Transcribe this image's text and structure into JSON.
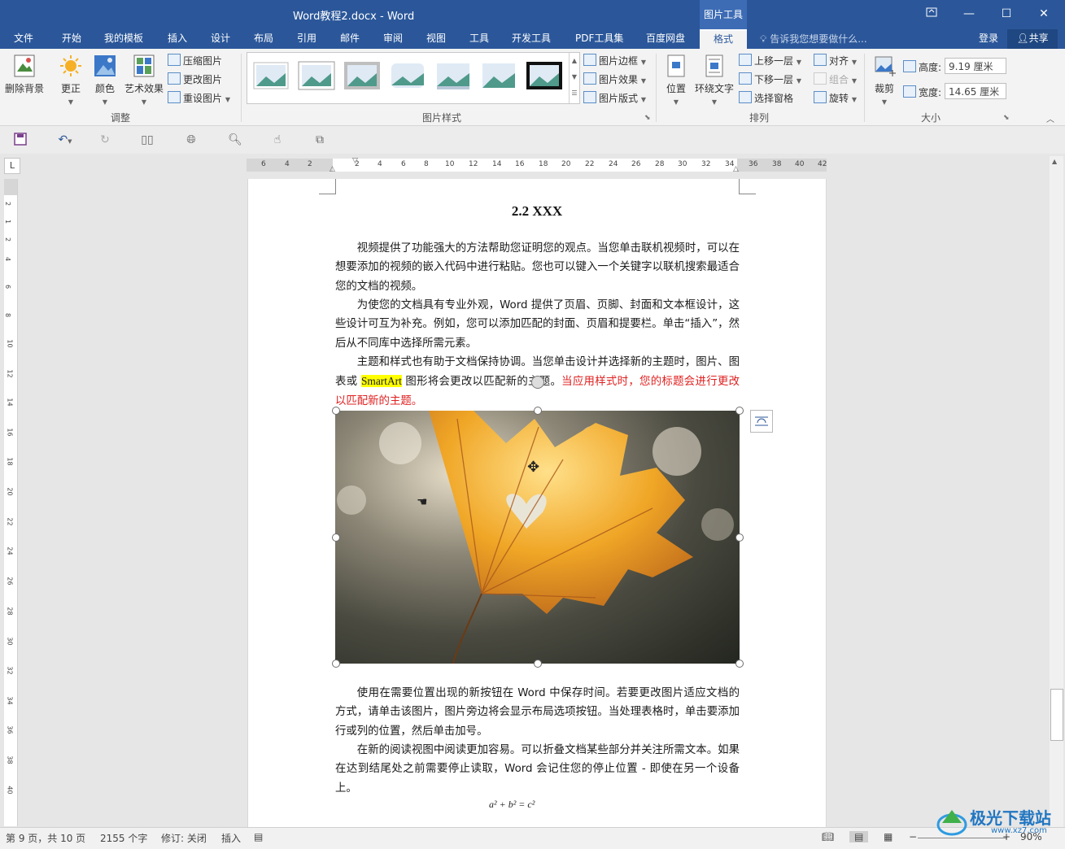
{
  "window": {
    "title": "Word教程2.docx - Word",
    "context_group": "图片工具",
    "restore_icon": "ribbon-display-icon",
    "minimize": "—",
    "maximize": "☐",
    "close": "✕"
  },
  "tabs": [
    "文件",
    "开始",
    "我的模板",
    "插入",
    "设计",
    "布局",
    "引用",
    "邮件",
    "审阅",
    "视图",
    "工具",
    "开发工具",
    "PDF工具集",
    "百度网盘",
    "格式"
  ],
  "active_tab": "格式",
  "tell_me": "告诉我您想要做什么...",
  "login": "登录",
  "share": "共享",
  "ribbon": {
    "adjust": {
      "remove_bg": "删除背景",
      "corrections": "更正",
      "color": "颜色",
      "artistic": "艺术效果",
      "compress": "压缩图片",
      "change": "更改图片",
      "reset": "重设图片",
      "label": "调整"
    },
    "styles": {
      "border": "图片边框",
      "effects": "图片效果",
      "layout": "图片版式",
      "label": "图片样式"
    },
    "arrange": {
      "position": "位置",
      "wrap": "环绕文字",
      "forward": "上移一层",
      "backward": "下移一层",
      "selection": "选择窗格",
      "align": "对齐",
      "group": "组合",
      "rotate": "旋转",
      "label": "排列"
    },
    "size": {
      "crop": "裁剪",
      "height_label": "高度:",
      "height_value": "9.19 厘米",
      "width_label": "宽度:",
      "width_value": "14.65 厘米",
      "label": "大小"
    }
  },
  "ruler": {
    "h_numbers": [
      "6",
      "4",
      "2",
      "2",
      "4",
      "6",
      "8",
      "10",
      "12",
      "14",
      "16",
      "18",
      "20",
      "22",
      "24",
      "26",
      "28",
      "30",
      "32",
      "34",
      "36",
      "38",
      "40",
      "42"
    ],
    "v_numbers": [
      "2",
      "1",
      "2",
      "4",
      "6",
      "8",
      "10",
      "12",
      "14",
      "16",
      "18",
      "20",
      "22",
      "24",
      "26",
      "28",
      "30",
      "32",
      "34",
      "36",
      "38",
      "40"
    ],
    "tab_selector": "L"
  },
  "document": {
    "heading": "2.2 XXX",
    "p1": "视频提供了功能强大的方法帮助您证明您的观点。当您单击联机视频时，可以在想要添加的视频的嵌入代码中进行粘贴。您也可以键入一个关键字以联机搜索最适合您的文档的视频。",
    "p2": "为使您的文档具有专业外观，Word 提供了页眉、页脚、封面和文本框设计，这些设计可互为补充。例如，您可以添加匹配的封面、页眉和提要栏。单击“插入”，然后从不同库中选择所需元素。",
    "p3_a": "主题和样式也有助于文档保持协调。当您单击设计并选择新的主题时，图片、图表或 ",
    "p3_hl": "SmartArt",
    "p3_b": " 图形将会更改以匹配新的主题。",
    "p3_red": "当应用样式时，您的标题会进行更改以匹配新的主题。",
    "p4": "使用在需要位置出现的新按钮在 Word 中保存时间。若要更改图片适应文档的方式，请单击该图片，图片旁边将会显示布局选项按钮。当处理表格时，单击要添加行或列的位置，然后单击加号。",
    "p5": "在新的阅读视图中阅读更加容易。可以折叠文档某些部分并关注所需文本。如果在达到结尾处之前需要停止读取，Word 会记住您的停止位置 - 即使在另一个设备上。",
    "formula": "a² + b² = c²"
  },
  "status": {
    "page": "第 9 页，共 10 页",
    "words": "2155 个字",
    "revision": "修订: 关闭",
    "insert": "插入",
    "zoom": "90%"
  },
  "watermark": "极光下载站",
  "watermark_url": "www.xz7.com",
  "colors": {
    "brand": "#2b579a",
    "highlight": "#ffff00",
    "red_text": "#e02020"
  }
}
